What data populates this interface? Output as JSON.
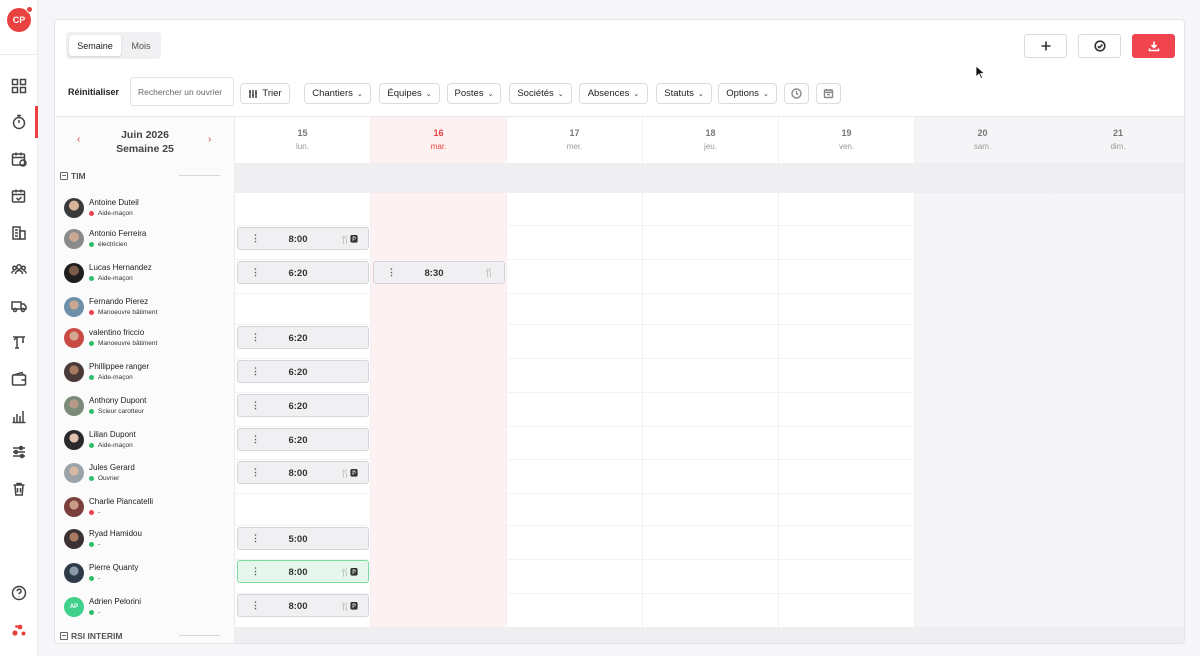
{
  "sidebar": {
    "logo": "CP",
    "icons": [
      "dashboard-icon",
      "stopwatch-icon",
      "calendar-clock-icon",
      "calendar-check-icon",
      "building-icon",
      "team-icon",
      "truck-icon",
      "crane-icon",
      "wallet-icon",
      "bar-chart-icon",
      "sliders-icon",
      "trash-icon"
    ],
    "bottom_icons": [
      "help-icon",
      "brand-icon"
    ]
  },
  "toolbar": {
    "view_week": "Semaine",
    "view_month": "Mois",
    "reset": "Réinitialiser",
    "search_placeholder": "Rechercher un ouvrier",
    "sort": "Trier",
    "filters": [
      "Chantiers",
      "Équipes",
      "Postes",
      "Sociétés",
      "Absences",
      "Statuts",
      "Options"
    ]
  },
  "calendar": {
    "month": "Juin 2026",
    "week": "Semaine 25",
    "days": [
      {
        "num": "15",
        "name": "lun."
      },
      {
        "num": "16",
        "name": "mar."
      },
      {
        "num": "17",
        "name": "mer."
      },
      {
        "num": "18",
        "name": "jeu."
      },
      {
        "num": "19",
        "name": "ven."
      },
      {
        "num": "20",
        "name": "sam."
      },
      {
        "num": "21",
        "name": "dim."
      }
    ]
  },
  "groups": {
    "first": "TIM",
    "second": "RSI INTERIM"
  },
  "workers": [
    {
      "name": "Antoine Duteil",
      "role": "Aide-maçon",
      "status": "#e8434d"
    },
    {
      "name": "Antonio Ferreira",
      "role": "électricien",
      "status": "#2ebd6b"
    },
    {
      "name": "Lucas Hernandez",
      "role": "Aide-maçon",
      "status": "#2ebd6b"
    },
    {
      "name": "Fernando Pierez",
      "role": "Manoeuvre bâtiment",
      "status": "#e8434d"
    },
    {
      "name": "valentino friccio",
      "role": "Manoeuvre bâtiment",
      "status": "#2ebd6b"
    },
    {
      "name": "Phillippee ranger",
      "role": "Aide-maçon",
      "status": "#2ebd6b"
    },
    {
      "name": "Anthony Dupont",
      "role": "Scieur carotteur",
      "status": "#2ebd6b"
    },
    {
      "name": "Lilian Dupont",
      "role": "Aide-maçon",
      "status": "#2ebd6b"
    },
    {
      "name": "Jules Gerard",
      "role": "Ouvrier",
      "status": "#2ebd6b"
    },
    {
      "name": "Charlie Piancatelli",
      "role": "-",
      "status": "#e8434d"
    },
    {
      "name": "Ryad Hamidou",
      "role": "-",
      "status": "#2ebd6b"
    },
    {
      "name": "Pierre Quanty",
      "role": "-",
      "status": "#2ebd6b"
    },
    {
      "name": "Adrien Pelorini",
      "role": "-",
      "status": "#2ebd6b",
      "initials": "AP"
    }
  ],
  "shifts": [
    {
      "time": "8:00",
      "meal": "🍴🅿"
    },
    {
      "time": "6:20"
    },
    {
      "time": "8:30",
      "meal": "🍴"
    },
    {
      "time": "6:20"
    },
    {
      "time": "6:20"
    },
    {
      "time": "6:20"
    },
    {
      "time": "6:20"
    },
    {
      "time": "8:00",
      "meal": "🍴🅿"
    },
    {
      "time": "5:00"
    },
    {
      "time": "8:00",
      "meal": "🍴🅿"
    },
    {
      "time": "8:00",
      "meal": "🍴🅿"
    }
  ],
  "colors": {
    "accent": "#e8413f",
    "today_bg": "#fdf1f1",
    "validated": "#7ed9a0"
  }
}
